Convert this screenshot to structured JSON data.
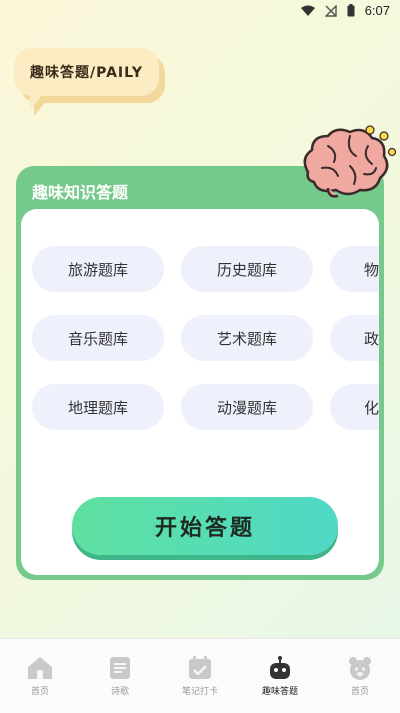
{
  "status": {
    "time": "6:07"
  },
  "bubble": {
    "text": "趣味答题/PAILY"
  },
  "card": {
    "title": "趣味知识答题",
    "rows": [
      [
        "旅游题库",
        "历史题库",
        "物理"
      ],
      [
        "音乐题库",
        "艺术题库",
        "政治"
      ],
      [
        "地理题库",
        "动漫题库",
        "化学"
      ]
    ],
    "start_label": "开始答题"
  },
  "tabs": [
    {
      "label": "首页",
      "icon": "home-icon"
    },
    {
      "label": "诗歌",
      "icon": "document-icon"
    },
    {
      "label": "笔记打卡",
      "icon": "calendar-check-icon"
    },
    {
      "label": "趣味答题",
      "icon": "robot-icon",
      "active": true
    },
    {
      "label": "首页",
      "icon": "bear-face-icon"
    }
  ],
  "colors": {
    "card_green": "#74c98b",
    "button_gradient_start": "#5fe0a0",
    "button_gradient_end": "#4fd9c6",
    "pill_bg": "#eef0fb"
  }
}
